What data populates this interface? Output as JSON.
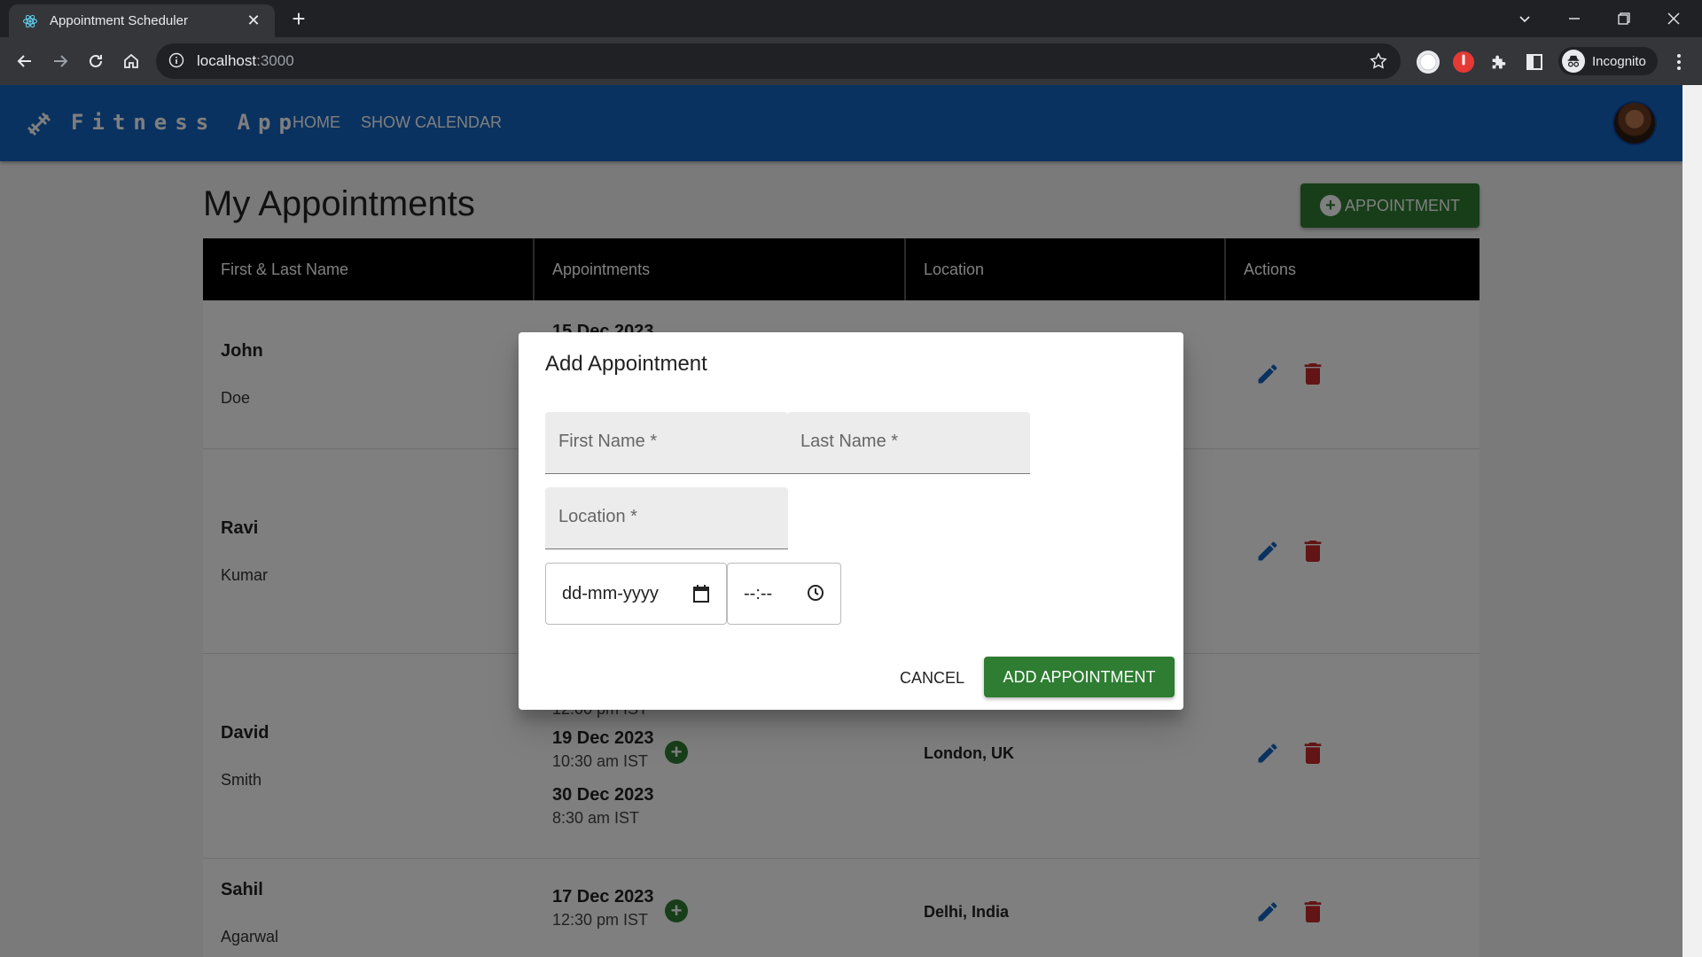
{
  "browser": {
    "tab_title": "Appointment Scheduler",
    "url_host": "localhost",
    "url_port": ":3000",
    "profile_label": "Incognito"
  },
  "app": {
    "brand": "Fitness App",
    "nav": [
      "HOME",
      "SHOW CALENDAR"
    ],
    "page_title": "My Appointments",
    "add_button_label": "APPOINTMENT"
  },
  "table": {
    "columns": [
      "First & Last Name",
      "Appointments",
      "Location",
      "Actions"
    ],
    "rows": [
      {
        "first": "John",
        "last": "Doe",
        "appointments": [
          {
            "date": "15 Dec 2023",
            "time": ""
          }
        ],
        "location": ""
      },
      {
        "first": "Ravi",
        "last": "Kumar",
        "appointments": [],
        "location": ""
      },
      {
        "first": "David",
        "last": "Smith",
        "appointments": [
          {
            "date": "",
            "time": "12:00 pm IST"
          },
          {
            "date": "19 Dec 2023",
            "time": "10:30 am IST"
          },
          {
            "date": "30 Dec 2023",
            "time": "8:30 am IST"
          }
        ],
        "location": "London, UK"
      },
      {
        "first": "Sahil",
        "last": "Agarwal",
        "appointments": [
          {
            "date": "17 Dec 2023",
            "time": "12:30 pm IST"
          }
        ],
        "location": "Delhi, India"
      }
    ]
  },
  "dialog": {
    "title": "Add Appointment",
    "first_name_label": "First Name *",
    "last_name_label": "Last Name *",
    "location_label": "Location *",
    "date_placeholder": "dd-mm-yyyy",
    "time_placeholder": "--:--",
    "cancel_label": "CANCEL",
    "submit_label": "ADD APPOINTMENT"
  },
  "colors": {
    "appbar": "#1565c0",
    "primary_green": "#2e7d32",
    "edit_blue": "#1565c0",
    "delete_red": "#c62828"
  }
}
